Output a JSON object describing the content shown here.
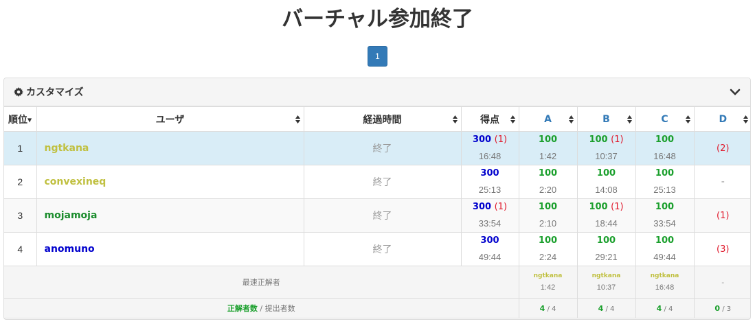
{
  "title": "バーチャル参加終了",
  "pagination": {
    "current": "1"
  },
  "panel": {
    "title": "カスタマイズ"
  },
  "headers": {
    "rank": "順位",
    "user": "ユーザ",
    "elapsed": "経過時間",
    "score": "得点",
    "problems": [
      "A",
      "B",
      "C",
      "D"
    ]
  },
  "rows": [
    {
      "rank": "1",
      "user": "ngtkana",
      "user_color": "#c0c040",
      "elapsed": "終了",
      "score": "300",
      "score_penalty": "(1)",
      "score_time": "16:48",
      "cells": [
        {
          "points": "100",
          "penalty": "",
          "time": "1:42"
        },
        {
          "points": "100",
          "penalty": "(1)",
          "time": "10:37"
        },
        {
          "points": "100",
          "penalty": "",
          "time": "16:48"
        },
        {
          "points": "",
          "penalty": "(2)",
          "time": ""
        }
      ]
    },
    {
      "rank": "2",
      "user": "convexineq",
      "user_color": "#c0c040",
      "elapsed": "終了",
      "score": "300",
      "score_penalty": "",
      "score_time": "25:13",
      "cells": [
        {
          "points": "100",
          "penalty": "",
          "time": "2:20"
        },
        {
          "points": "100",
          "penalty": "",
          "time": "14:08"
        },
        {
          "points": "100",
          "penalty": "",
          "time": "25:13"
        },
        {
          "points": "",
          "penalty": "",
          "time": "",
          "dash": "-"
        }
      ]
    },
    {
      "rank": "3",
      "user": "mojamoja",
      "user_color": "#1a8c2c",
      "elapsed": "終了",
      "score": "300",
      "score_penalty": "(1)",
      "score_time": "33:54",
      "cells": [
        {
          "points": "100",
          "penalty": "",
          "time": "2:10"
        },
        {
          "points": "100",
          "penalty": "(1)",
          "time": "18:44"
        },
        {
          "points": "100",
          "penalty": "",
          "time": "33:54"
        },
        {
          "points": "",
          "penalty": "(1)",
          "time": ""
        }
      ]
    },
    {
      "rank": "4",
      "user": "anomuno",
      "user_color": "#0000cd",
      "elapsed": "終了",
      "score": "300",
      "score_penalty": "",
      "score_time": "49:44",
      "cells": [
        {
          "points": "100",
          "penalty": "",
          "time": "2:24"
        },
        {
          "points": "100",
          "penalty": "",
          "time": "29:21"
        },
        {
          "points": "100",
          "penalty": "",
          "time": "49:44"
        },
        {
          "points": "",
          "penalty": "(3)",
          "time": ""
        }
      ]
    }
  ],
  "footer": {
    "fastest_label": "最速正解者",
    "fastest": [
      {
        "user": "ngtkana",
        "time": "1:42"
      },
      {
        "user": "ngtkana",
        "time": "10:37"
      },
      {
        "user": "ngtkana",
        "time": "16:48"
      },
      {
        "user": "",
        "time": "",
        "dash": "-"
      }
    ],
    "ac_label": "正解者数",
    "sub_label": " / 提出者数",
    "counts": [
      {
        "ac": "4",
        "sub": " / 4"
      },
      {
        "ac": "4",
        "sub": " / 4"
      },
      {
        "ac": "4",
        "sub": " / 4"
      },
      {
        "ac": "0",
        "sub": " / 3"
      }
    ]
  },
  "colors": {
    "accent": "#337ab7",
    "highlight_row": "#d9edf7",
    "accepted": "#1a9f2c",
    "penalty": "#e0182b"
  }
}
